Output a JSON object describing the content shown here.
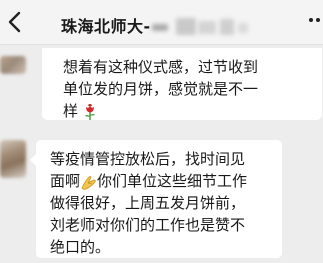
{
  "header": {
    "title": "珠海北师大-",
    "back_icon": "chevron-left-icon",
    "menu_icon": "more-dots-icon"
  },
  "messages": [
    {
      "lines": [
        "想着有这种仪式感，过节收到",
        "单位发的月饼，感觉就是不一",
        "样"
      ],
      "trailing_emoji": "rose-icon"
    },
    {
      "lines": [
        "等疫情管控放松后，找时间见",
        "面啊",
        "你们单位这些细节工作",
        "做得很好，上周五发月饼前，",
        "刘老师对你们的工作也是赞不",
        "绝口的。"
      ],
      "inline_emoji": "folded-hands-icon"
    }
  ],
  "colors": {
    "background": "#ededed",
    "header": "#f4f4f4",
    "bubble": "#ffffff",
    "text": "#191919"
  }
}
